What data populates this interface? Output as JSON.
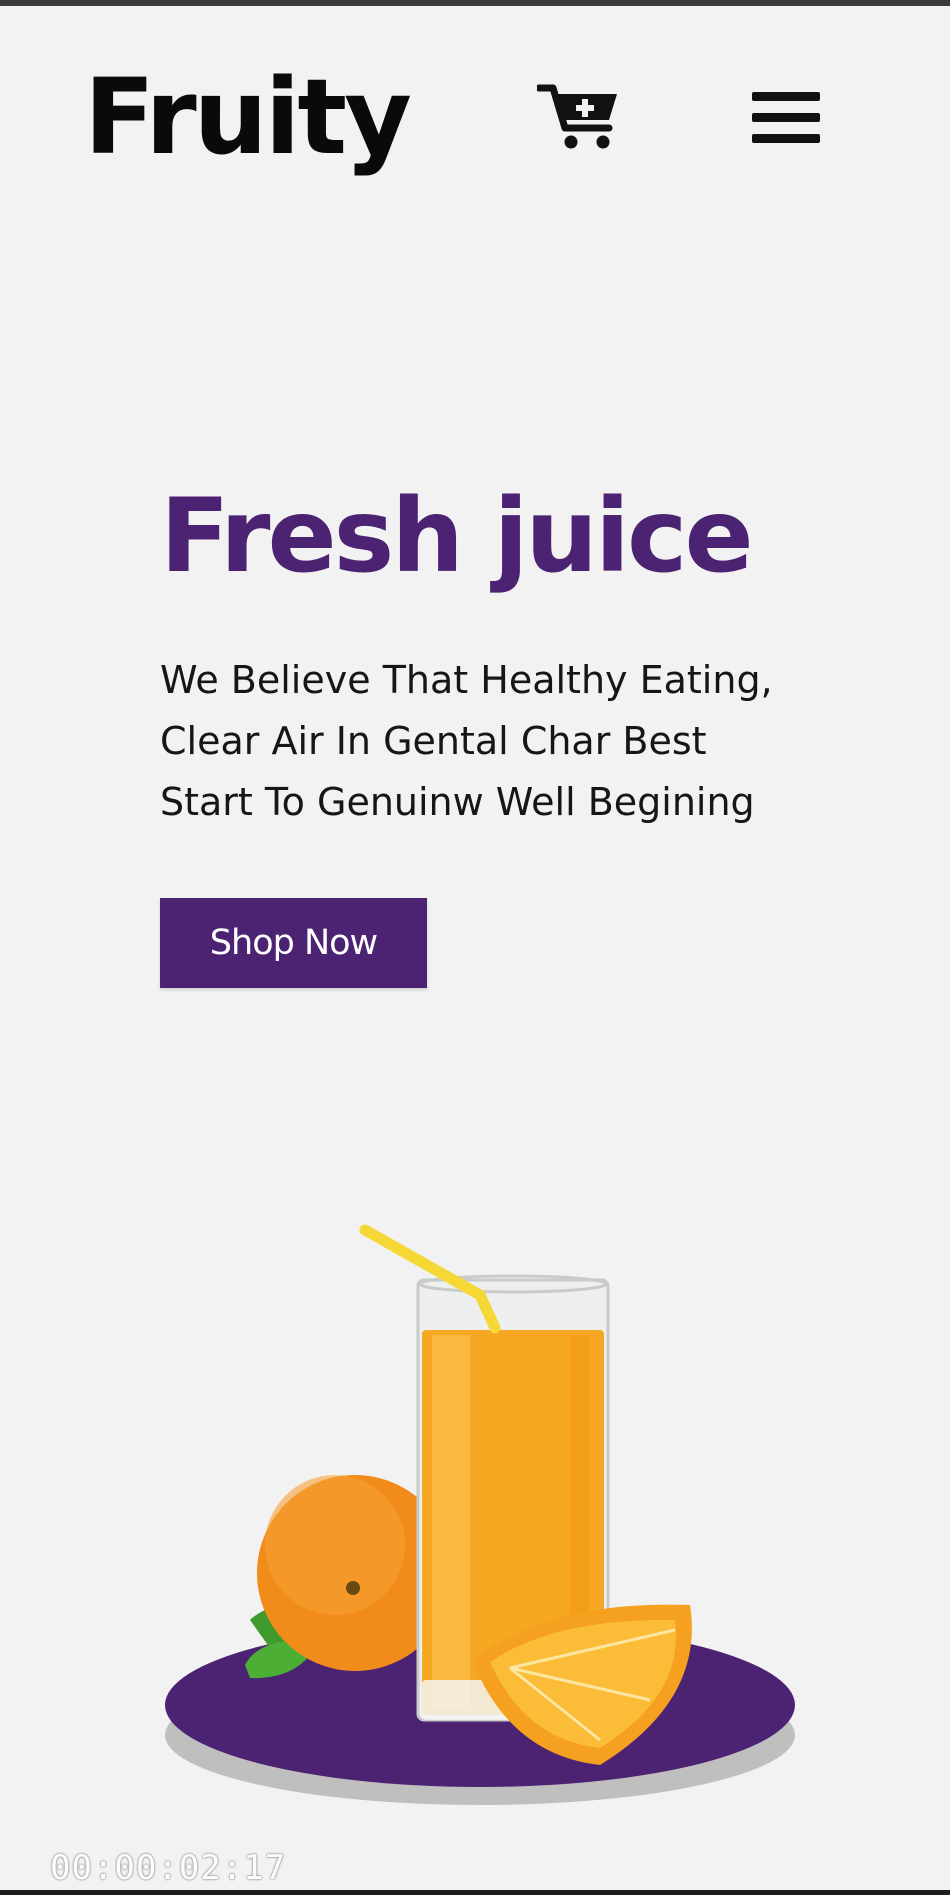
{
  "header": {
    "logo": "Fruity",
    "cart_icon": "cart-plus-icon",
    "menu_icon": "hamburger-menu-icon"
  },
  "hero": {
    "title": "Fresh juice",
    "description": "We Believe That Healthy Eating, Clear Air In Gental Char Best Start To Genuinw Well Begining",
    "cta_label": "Shop Now",
    "image": "orange-juice-glass-with-oranges"
  },
  "overlay": {
    "timestamp": "00:00:02:17"
  },
  "colors": {
    "background": "#f2f2f2",
    "accent_purple": "#4b2372",
    "text_dark": "#111111",
    "juice_orange": "#f7a823"
  }
}
